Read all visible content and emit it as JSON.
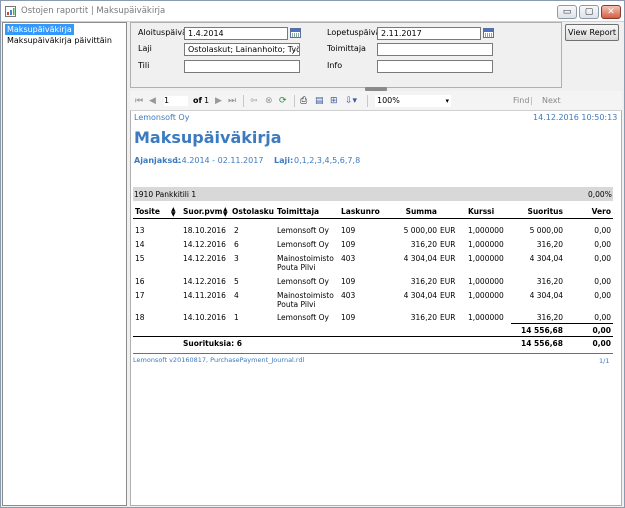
{
  "window": {
    "title": "Ostojen raportit | Maksupäiväkirja",
    "buttons": {
      "minimize": "▭",
      "maximize": "▢",
      "close": "✕"
    }
  },
  "sidebar": {
    "items": [
      {
        "label": "Maksupäiväkirja",
        "selected": true
      },
      {
        "label": "Maksupäiväkirja päivittäin",
        "selected": false
      }
    ]
  },
  "params": {
    "aloituspaiva_label": "Aloituspäivä",
    "aloituspaiva_value": "1.4.2014",
    "lopetuspaiva_label": "Lopetuspäivä",
    "lopetuspaiva_value": "2.11.2017",
    "laji_label": "Laji",
    "laji_value": "Ostolaskut; Lainanhoito; Työna",
    "toimittaja_label": "Toimittaja",
    "toimittaja_value": "",
    "tili_label": "Tili",
    "tili_value": "",
    "info_label": "Info",
    "info_value": "",
    "view_report": "View Report"
  },
  "toolbar": {
    "page": "1",
    "of_label": "of",
    "total_pages": "1",
    "zoom": "100%",
    "find": "Find",
    "separator": "|",
    "next": "Next"
  },
  "report": {
    "company": "Lemonsoft Oy",
    "timestamp": "14.12.2016 10:50:13",
    "title": "Maksupäiväkirja",
    "period_label": "Ajanjakso:",
    "period_value": "1.4.2014 - 02.11.2017",
    "laji_label": "Laji:",
    "laji_value": "0,1,2,3,4,5,6,7,8",
    "group": {
      "account": "1910 Pankkitili 1",
      "percent": "0,00%"
    },
    "columns": {
      "tosite": "Tosite",
      "suor_pvm": "Suor.pvm",
      "ostolasku": "Ostolasku",
      "toimittaja": "Toimittaja",
      "laskunro": "Laskunro",
      "summa": "Summa",
      "kurssi": "Kurssi",
      "suoritus": "Suoritus",
      "vero": "Vero"
    },
    "rows": [
      {
        "tosite": "13",
        "pvm": "18.10.2016",
        "ostolasku": "2",
        "toimittaja": "Lemonsoft Oy",
        "toimittaja2": "",
        "laskunro": "109",
        "summa": "5 000,00",
        "cur": "EUR",
        "kurssi": "1,000000",
        "suoritus": "5 000,00",
        "vero": "0,00"
      },
      {
        "tosite": "14",
        "pvm": "14.12.2016",
        "ostolasku": "6",
        "toimittaja": "Lemonsoft Oy",
        "toimittaja2": "",
        "laskunro": "109",
        "summa": "316,20",
        "cur": "EUR",
        "kurssi": "1,000000",
        "suoritus": "316,20",
        "vero": "0,00"
      },
      {
        "tosite": "15",
        "pvm": "14.12.2016",
        "ostolasku": "3",
        "toimittaja": "Mainostoimisto",
        "toimittaja2": "Pouta Pilvi",
        "laskunro": "403",
        "summa": "4 304,04",
        "cur": "EUR",
        "kurssi": "1,000000",
        "suoritus": "4 304,04",
        "vero": "0,00"
      },
      {
        "tosite": "16",
        "pvm": "14.12.2016",
        "ostolasku": "5",
        "toimittaja": "Lemonsoft Oy",
        "toimittaja2": "",
        "laskunro": "109",
        "summa": "316,20",
        "cur": "EUR",
        "kurssi": "1,000000",
        "suoritus": "316,20",
        "vero": "0,00"
      },
      {
        "tosite": "17",
        "pvm": "14.11.2016",
        "ostolasku": "4",
        "toimittaja": "Mainostoimisto",
        "toimittaja2": "Pouta Pilvi",
        "laskunro": "403",
        "summa": "4 304,04",
        "cur": "EUR",
        "kurssi": "1,000000",
        "suoritus": "4 304,04",
        "vero": "0,00"
      },
      {
        "tosite": "18",
        "pvm": "14.10.2016",
        "ostolasku": "1",
        "toimittaja": "Lemonsoft Oy",
        "toimittaja2": "",
        "laskunro": "109",
        "summa": "316,20",
        "cur": "EUR",
        "kurssi": "1,000000",
        "suoritus": "316,20",
        "vero": "0,00"
      }
    ],
    "subtotal_suoritus": "14 556,68",
    "subtotal_vero": "0,00",
    "total_label": "Suorituksia: 6",
    "total_suoritus": "14 556,68",
    "total_vero": "0,00",
    "footer_left": "Lemonsoft v20160817, PurchasePayment_Journal.rdl",
    "footer_right": "1/1"
  },
  "colors": {
    "accent": "#3c7bbf",
    "selection": "#3399ff",
    "group_band": "#d8d8d8"
  }
}
